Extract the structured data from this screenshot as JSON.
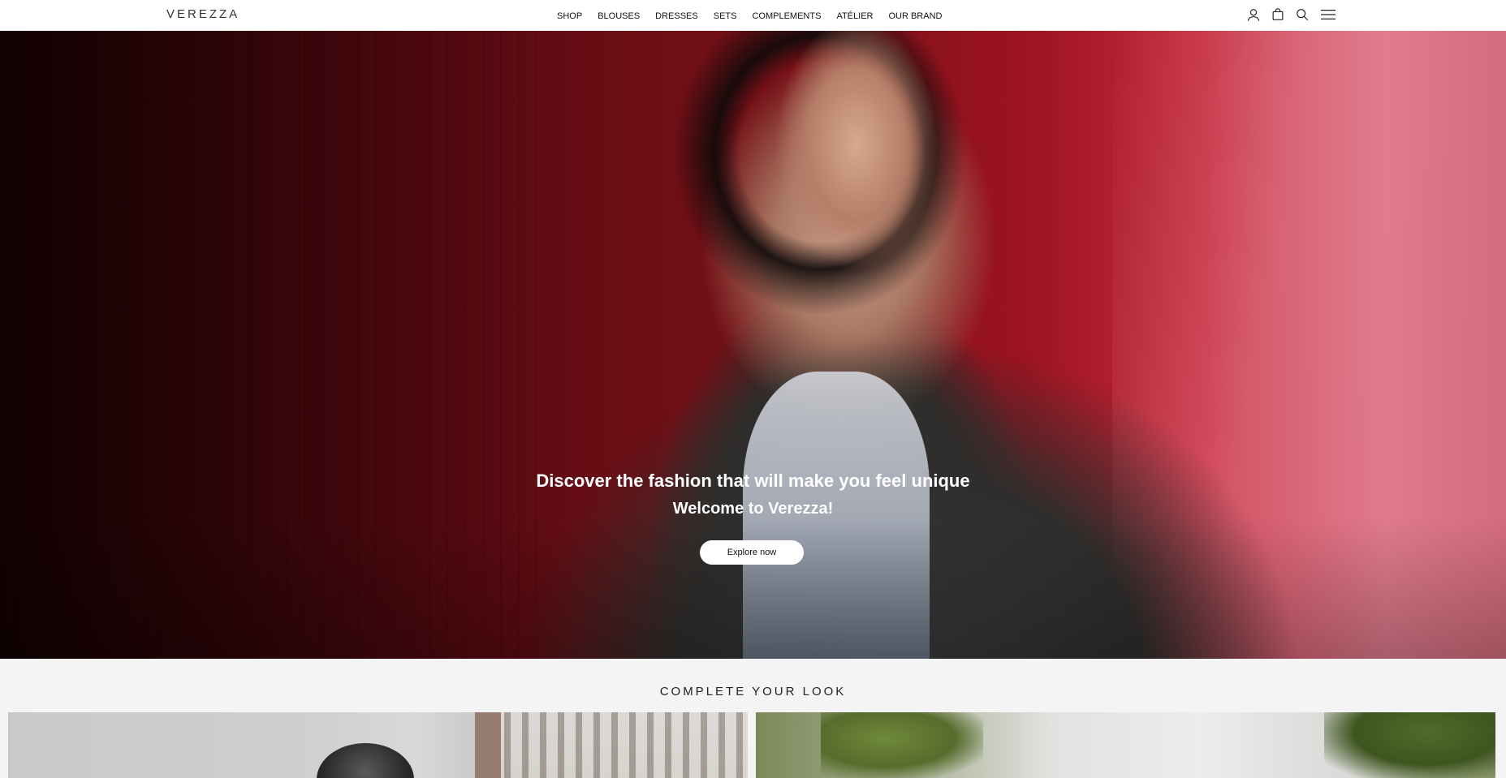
{
  "header": {
    "logo": "VEREZZA",
    "nav": [
      "SHOP",
      "BLOUSES",
      "DRESSES",
      "SETS",
      "COMPLEMENTS",
      "ATÉLIER",
      "OUR BRAND"
    ],
    "icons": [
      "user-icon",
      "bag-icon",
      "search-icon",
      "menu-icon"
    ]
  },
  "hero": {
    "title": "Discover the fashion that will make you feel unique",
    "subtitle": "Welcome to Verezza!",
    "button_label": "Explore now"
  },
  "section": {
    "title": "COMPLETE YOUR LOOK"
  },
  "colors": {
    "hero_red": "#7a1219",
    "button_bg": "#ffffff",
    "page_bg": "#f4f4f4"
  }
}
